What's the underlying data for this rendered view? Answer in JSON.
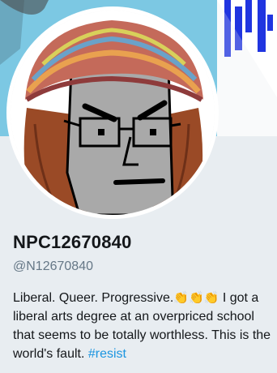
{
  "profile": {
    "display_name": "NPC12670840",
    "handle": "@N12670840",
    "bio_text_1": "Liberal. Queer. Progressive.",
    "bio_emojis": [
      "👏",
      "👏",
      "👏"
    ],
    "bio_text_2": " I got a liberal arts degree at an overpriced school that seems to be totally worthless. This is the world's fault. ",
    "bio_hashtag": "#resist"
  },
  "colors": {
    "banner": "#79c8e4",
    "card_background": "#e8edf1",
    "hashtag": "#1b95e0",
    "handle": "#657786"
  },
  "icons": {
    "avatar": "npc-face-with-knit-hat-avatar"
  }
}
